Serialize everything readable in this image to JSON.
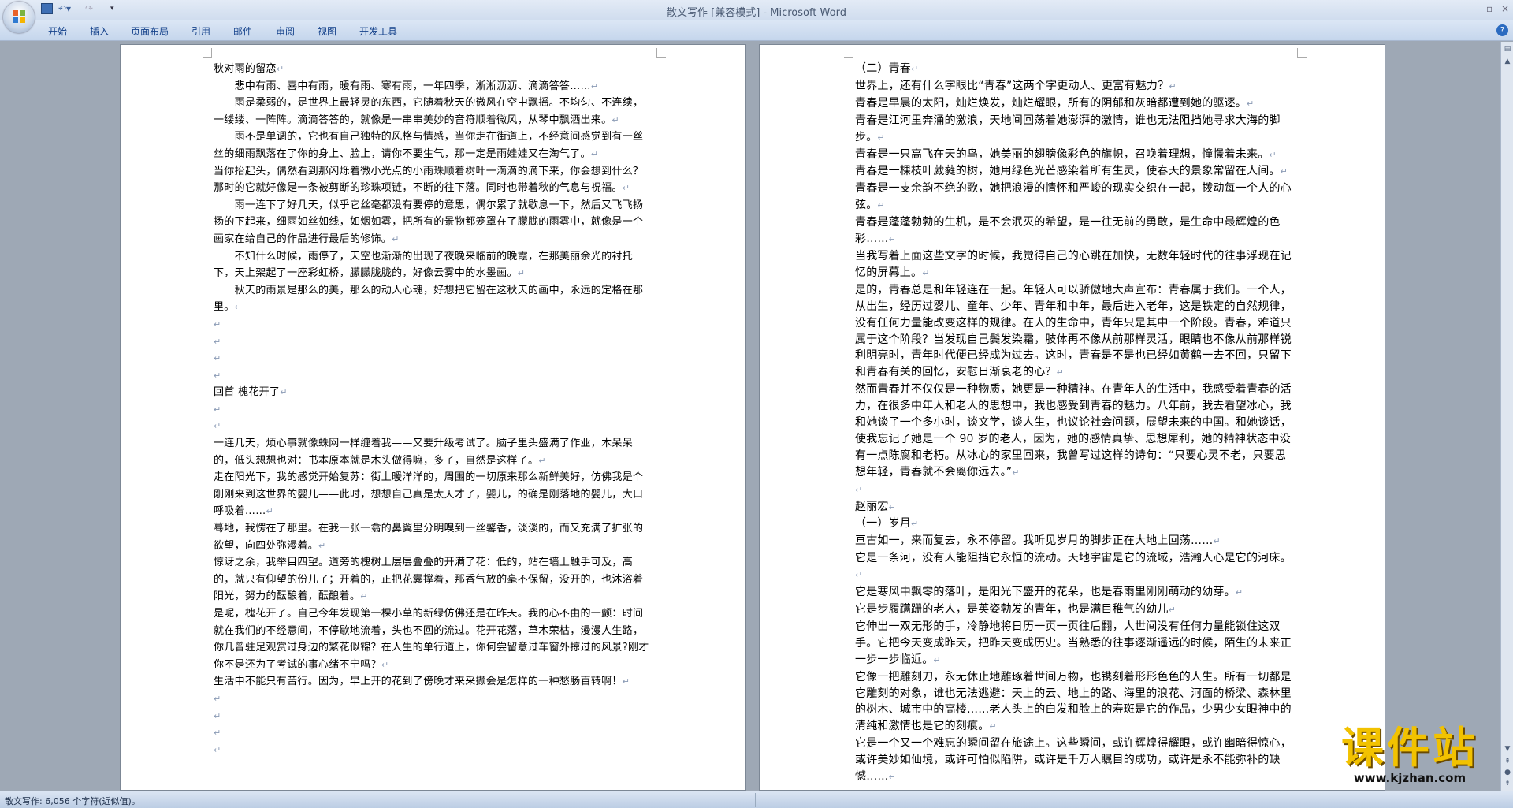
{
  "window": {
    "title": "散文写作 [兼容模式] - Microsoft Word",
    "controls": [
      "–",
      "▫",
      "×"
    ]
  },
  "quick_access": {
    "more_glyph": "▾"
  },
  "ribbon": {
    "tabs": [
      "开始",
      "插入",
      "页面布局",
      "引用",
      "邮件",
      "审阅",
      "视图",
      "开发工具"
    ]
  },
  "document": {
    "pilcrow": "↵",
    "page1": [
      "秋对雨的留恋",
      "　　悲中有雨、喜中有雨，暖有雨、寒有雨，一年四季，淅淅沥沥、滴滴答答……",
      "　　雨是柔弱的，是世界上最轻灵的东西，它随着秋天的微风在空中飘摇。不均匀、不连续，一缕缕、一阵阵。滴滴答答的，就像是一串串美妙的音符顺着微风，从琴中飘洒出来。",
      "　　雨不是单调的，它也有自己独特的风格与情感，当你走在街道上，不经意间感觉到有一丝丝的细雨飘落在了你的身上、脸上，请你不要生气，那一定是雨娃娃又在淘气了。",
      "当你抬起头，偶然看到那闪烁着微小光点的小雨珠顺着树叶一滴滴的滴下来，你会想到什么？那时的它就好像是一条被剪断的珍珠项链，不断的往下落。同时也带着秋的气息与祝福。",
      "　　雨一连下了好几天，似乎它丝毫都没有要停的意思，偶尔累了就歇息一下，然后又飞飞扬扬的下起来，细雨如丝如线，如烟如雾，把所有的景物都笼罩在了朦胧的雨雾中，就像是一个画家在给自己的作品进行最后的修饰。",
      "　　不知什么时候，雨停了，天空也渐渐的出现了夜晚来临前的晚霞，在那美丽余光的衬托下，天上架起了一座彩虹桥，朦朦胧胧的，好像云雾中的水墨画。",
      "　　秋天的雨景是那么的美，那么的动人心魂，好想把它留在这秋天的画中，永远的定格在那里。",
      "",
      "",
      "",
      "",
      "回首 槐花开了",
      "",
      "",
      "一连几天，烦心事就像蛛网一样缠着我——又要升级考试了。脑子里头盛满了作业，木呆呆的，低头想想也对：书本原本就是木头做得嘛，多了，自然是这样了。",
      "走在阳光下，我的感觉开始复苏：街上暖洋洋的，周围的一切原来那么新鲜美好，仿佛我是个刚刚来到这世界的婴儿——此时，想想自己真是太天才了，婴儿，的确是刚落地的婴儿，大口呼吸着……",
      "蓦地，我愣在了那里。在我一张一翕的鼻翼里分明嗅到一丝馨香，淡淡的，而又充满了扩张的欲望，向四处弥漫着。",
      "惊讶之余，我举目四望。道旁的槐树上层层叠叠的开满了花：低的，站在墙上触手可及，高的，就只有仰望的份儿了；开着的，正把花囊撑着，那香气放的毫不保留，没开的，也沐浴着阳光，努力的酝酿着，酝酿着。",
      "是呢，槐花开了。自己今年发现第一棵小草的新绿仿佛还是在昨天。我的心不由的一颤：时间就在我们的不经意间，不停歇地流着，头也不回的流过。花开花落，草木荣枯，漫漫人生路，你几曾驻足观赏过身边的繁花似锦？在人生的单行道上，你何尝留意过车窗外掠过的风景?刚才你不是还为了考试的事心绪不宁吗？",
      "生活中不能只有苦行。因为，早上开的花到了傍晚才来采撷会是怎样的一种愁肠百转啊！",
      "",
      "",
      "",
      ""
    ],
    "page2": [
      "（二）青春",
      "世界上，还有什么字眼比“青春”这两个字更动人、更富有魅力？",
      "青春是早晨的太阳，灿烂焕发，灿烂耀眼，所有的阴郁和灰暗都遭到她的驱逐。",
      "青春是江河里奔涌的激浪，天地间回荡着她澎湃的激情，谁也无法阻挡她寻求大海的脚步。",
      "青春是一只高飞在天的鸟，她美丽的翅膀像彩色的旗帜，召唤着理想，憧憬着未来。",
      "青春是一棵枝叶葳蕤的树，她用绿色光芒感染着所有生灵，使春天的景象常留在人间。",
      "青春是一支余韵不绝的歌，她把浪漫的情怀和严峻的现实交织在一起，拨动每一个人的心弦。",
      "青春是蓬蓬勃勃的生机，是不会泯灭的希望，是一往无前的勇敢，是生命中最辉煌的色彩……",
      "当我写着上面这些文字的时候，我觉得自己的心跳在加快，无数年轻时代的往事浮现在记忆的屏幕上。",
      "是的，青春总是和年轻连在一起。年轻人可以骄傲地大声宣布：青春属于我们。一个人，从出生，经历过婴儿、童年、少年、青年和中年，最后进入老年，这是铁定的自然规律，没有任何力量能改变这样的规律。在人的生命中，青年只是其中一个阶段。青春，难道只属于这个阶段？当发现自己鬓发染霜，肢体再不像从前那样灵活，眼睛也不像从前那样锐利明亮时，青年时代便已经成为过去。这时，青春是不是也已经如黄鹤一去不回，只留下和青春有关的回忆，安慰日渐衰老的心？",
      "然而青春并不仅仅是一种物质，她更是一种精神。在青年人的生活中，我感受着青春的活力，在很多中年人和老人的思想中，我也感受到青春的魅力。八年前，我去看望冰心，我和她谈了一个多小时，谈文学，谈人生，也议论社会问题，展望未来的中国。和她谈话，使我忘记了她是一个 90 岁的老人，因为，她的感情真挚、思想犀利，她的精神状态中没有一点陈腐和老朽。从冰心的家里回来，我曾写过这样的诗句：“只要心灵不老，只要思想年轻，青春就不会离你远去。”",
      "",
      "赵丽宏",
      "（一）岁月",
      "亘古如一，来而复去，永不停留。我听见岁月的脚步正在大地上回荡……",
      "它是一条河，没有人能阻挡它永恒的流动。天地宇宙是它的流域，浩瀚人心是它的河床。",
      "它是寒风中飘零的落叶，是阳光下盛开的花朵，也是春雨里刚刚萌动的幼芽。",
      "它是步履蹒跚的老人，是英姿勃发的青年，也是满目稚气的幼儿",
      "它伸出一双无形的手，冷静地将日历一页一页往后翻，人世间没有任何力量能锁住这双手。它把今天变成昨天，把昨天变成历史。当熟悉的往事逐渐遥远的时候，陌生的未来正一步一步临近。",
      "它像一把雕刻刀，永无休止地雕琢着世间万物，也镌刻着形形色色的人生。所有一切都是它雕刻的对象，谁也无法逃避：天上的云、地上的路、海里的浪花、河面的桥梁、森林里的树木、城市中的高楼……老人头上的白发和脸上的寿斑是它的作品，少男少女眼神中的清纯和激情也是它的刻痕。",
      "它是一个又一个难忘的瞬间留在旅途上。这些瞬间，或许辉煌得耀眼，或许幽暗得惊心，或许美妙如仙境，或许可怕似陷阱，或许是千万人瞩目的成功，或许是永不能弥补的缺憾……"
    ]
  },
  "statusbar": {
    "text": "散文写作: 6,056 个字符(近似值)。"
  },
  "watermark": {
    "main": "课件站",
    "url": "www.kjzhan.com"
  }
}
